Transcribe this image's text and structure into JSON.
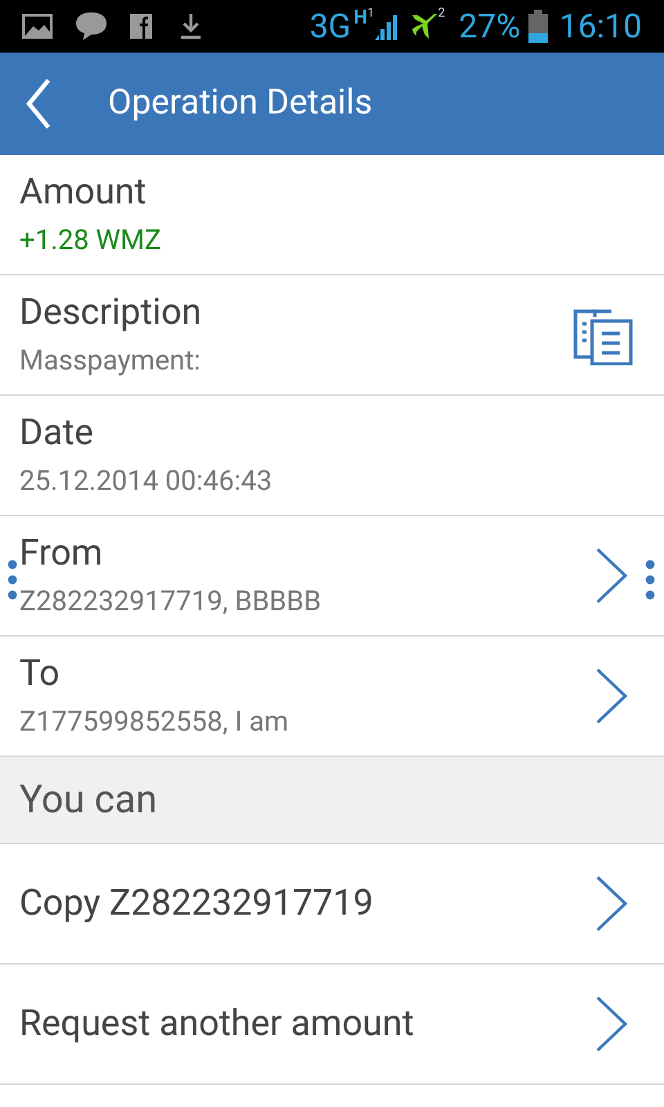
{
  "status_bar": {
    "network": "3G",
    "network_type": "H",
    "sim_1": "1",
    "sim_2": "2",
    "battery": "27%",
    "time": "16:10"
  },
  "header": {
    "title": "Operation Details"
  },
  "details": [
    {
      "kind": "plain",
      "label": "Amount",
      "value": "+1.28 WMZ",
      "positive": true,
      "selected": false
    },
    {
      "kind": "copy",
      "label": "Description",
      "value": "Masspayment:",
      "positive": false,
      "selected": false
    },
    {
      "kind": "plain",
      "label": "Date",
      "value": "25.12.2014 00:46:43",
      "positive": false,
      "selected": false
    },
    {
      "kind": "link",
      "label": "From",
      "value": "Z282232917719, BBBBB",
      "positive": false,
      "selected": true
    },
    {
      "kind": "link",
      "label": "To",
      "value": "Z177599852558, I am",
      "positive": false,
      "selected": false
    }
  ],
  "section": {
    "title": "You can"
  },
  "actions": [
    {
      "label": "Copy Z282232917719"
    },
    {
      "label": "Request another amount"
    }
  ]
}
